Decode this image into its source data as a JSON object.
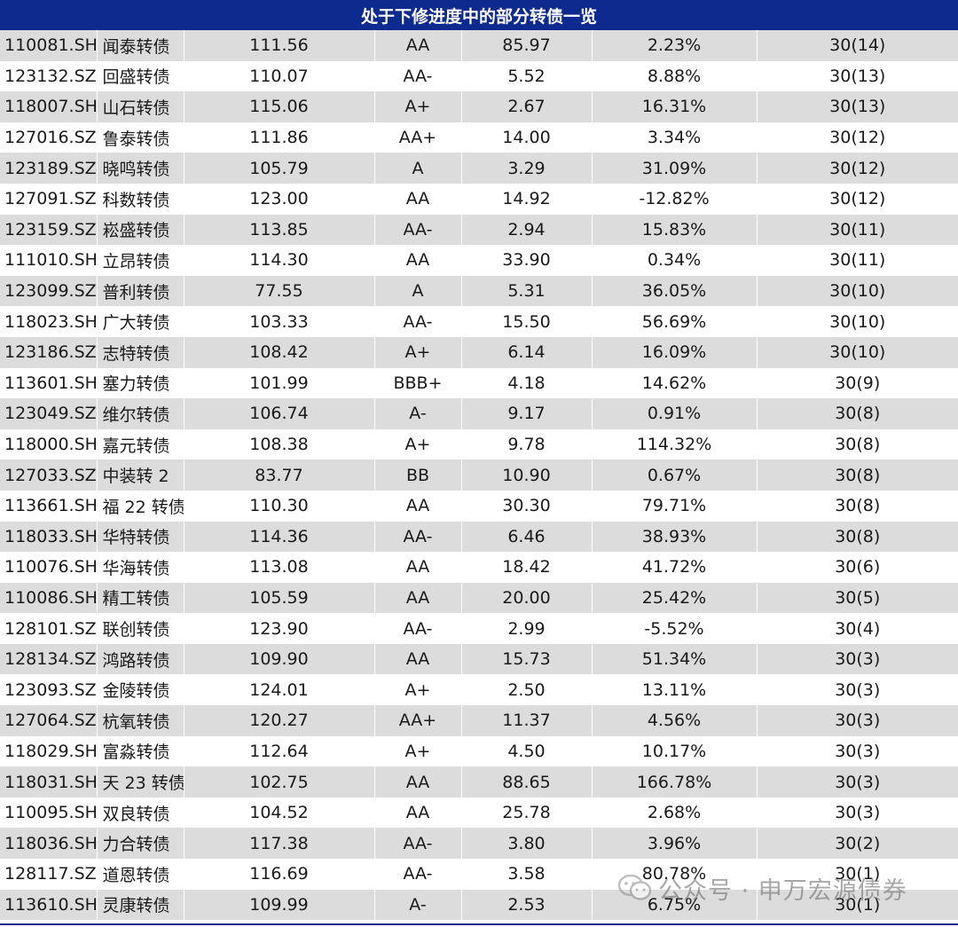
{
  "table": {
    "title": "处于下修进度中的部分转债一览",
    "rows": [
      {
        "code": "110081.SH",
        "name": "闻泰转债",
        "price": "111.56",
        "rating": "AA",
        "balance": "85.97",
        "premium": "2.23%",
        "progress": "30(14)"
      },
      {
        "code": "123132.SZ",
        "name": "回盛转债",
        "price": "110.07",
        "rating": "AA-",
        "balance": "5.52",
        "premium": "8.88%",
        "progress": "30(13)"
      },
      {
        "code": "118007.SH",
        "name": "山石转债",
        "price": "115.06",
        "rating": "A+",
        "balance": "2.67",
        "premium": "16.31%",
        "progress": "30(13)"
      },
      {
        "code": "127016.SZ",
        "name": "鲁泰转债",
        "price": "111.86",
        "rating": "AA+",
        "balance": "14.00",
        "premium": "3.34%",
        "progress": "30(12)"
      },
      {
        "code": "123189.SZ",
        "name": "晓鸣转债",
        "price": "105.79",
        "rating": "A",
        "balance": "3.29",
        "premium": "31.09%",
        "progress": "30(12)"
      },
      {
        "code": "127091.SZ",
        "name": "科数转债",
        "price": "123.00",
        "rating": "AA",
        "balance": "14.92",
        "premium": "-12.82%",
        "progress": "30(12)"
      },
      {
        "code": "123159.SZ",
        "name": "崧盛转债",
        "price": "113.85",
        "rating": "AA-",
        "balance": "2.94",
        "premium": "15.83%",
        "progress": "30(11)"
      },
      {
        "code": "111010.SH",
        "name": "立昂转债",
        "price": "114.30",
        "rating": "AA",
        "balance": "33.90",
        "premium": "0.34%",
        "progress": "30(11)"
      },
      {
        "code": "123099.SZ",
        "name": "普利转债",
        "price": "77.55",
        "rating": "A",
        "balance": "5.31",
        "premium": "36.05%",
        "progress": "30(10)"
      },
      {
        "code": "118023.SH",
        "name": "广大转债",
        "price": "103.33",
        "rating": "AA-",
        "balance": "15.50",
        "premium": "56.69%",
        "progress": "30(10)"
      },
      {
        "code": "123186.SZ",
        "name": "志特转债",
        "price": "108.42",
        "rating": "A+",
        "balance": "6.14",
        "premium": "16.09%",
        "progress": "30(10)"
      },
      {
        "code": "113601.SH",
        "name": "塞力转债",
        "price": "101.99",
        "rating": "BBB+",
        "balance": "4.18",
        "premium": "14.62%",
        "progress": "30(9)"
      },
      {
        "code": "123049.SZ",
        "name": "维尔转债",
        "price": "106.74",
        "rating": "A-",
        "balance": "9.17",
        "premium": "0.91%",
        "progress": "30(8)"
      },
      {
        "code": "118000.SH",
        "name": "嘉元转债",
        "price": "108.38",
        "rating": "A+",
        "balance": "9.78",
        "premium": "114.32%",
        "progress": "30(8)"
      },
      {
        "code": "127033.SZ",
        "name": "中装转 2",
        "price": "83.77",
        "rating": "BB",
        "balance": "10.90",
        "premium": "0.67%",
        "progress": "30(8)"
      },
      {
        "code": "113661.SH",
        "name": "福 22 转债",
        "price": "110.30",
        "rating": "AA",
        "balance": "30.30",
        "premium": "79.71%",
        "progress": "30(8)"
      },
      {
        "code": "118033.SH",
        "name": "华特转债",
        "price": "114.36",
        "rating": "AA-",
        "balance": "6.46",
        "premium": "38.93%",
        "progress": "30(8)"
      },
      {
        "code": "110076.SH",
        "name": "华海转债",
        "price": "113.08",
        "rating": "AA",
        "balance": "18.42",
        "premium": "41.72%",
        "progress": "30(6)"
      },
      {
        "code": "110086.SH",
        "name": "精工转债",
        "price": "105.59",
        "rating": "AA",
        "balance": "20.00",
        "premium": "25.42%",
        "progress": "30(5)"
      },
      {
        "code": "128101.SZ",
        "name": "联创转债",
        "price": "123.90",
        "rating": "AA-",
        "balance": "2.99",
        "premium": "-5.52%",
        "progress": "30(4)"
      },
      {
        "code": "128134.SZ",
        "name": "鸿路转债",
        "price": "109.90",
        "rating": "AA",
        "balance": "15.73",
        "premium": "51.34%",
        "progress": "30(3)"
      },
      {
        "code": "123093.SZ",
        "name": "金陵转债",
        "price": "124.01",
        "rating": "A+",
        "balance": "2.50",
        "premium": "13.11%",
        "progress": "30(3)"
      },
      {
        "code": "127064.SZ",
        "name": "杭氧转债",
        "price": "120.27",
        "rating": "AA+",
        "balance": "11.37",
        "premium": "4.56%",
        "progress": "30(3)"
      },
      {
        "code": "118029.SH",
        "name": "富淼转债",
        "price": "112.64",
        "rating": "A+",
        "balance": "4.50",
        "premium": "10.17%",
        "progress": "30(3)"
      },
      {
        "code": "118031.SH",
        "name": "天 23 转债",
        "price": "102.75",
        "rating": "AA",
        "balance": "88.65",
        "premium": "166.78%",
        "progress": "30(3)"
      },
      {
        "code": "110095.SH",
        "name": "双良转债",
        "price": "104.52",
        "rating": "AA",
        "balance": "25.78",
        "premium": "2.68%",
        "progress": "30(3)"
      },
      {
        "code": "118036.SH",
        "name": "力合转债",
        "price": "117.38",
        "rating": "AA-",
        "balance": "3.80",
        "premium": "3.96%",
        "progress": "30(2)"
      },
      {
        "code": "128117.SZ",
        "name": "道恩转债",
        "price": "116.69",
        "rating": "AA-",
        "balance": "3.58",
        "premium": "80.78%",
        "progress": "30(1)"
      },
      {
        "code": "113610.SH",
        "name": "灵康转债",
        "price": "109.99",
        "rating": "A-",
        "balance": "2.53",
        "premium": "6.75%",
        "progress": "30(1)"
      }
    ]
  },
  "watermark": {
    "icon": "wechat-icon",
    "text": "公众号 · 申万宏源债券"
  },
  "colors": {
    "header_bg": "#0d2a8f",
    "header_text": "#ffffff",
    "row_stripe": "#dcdcdc"
  }
}
